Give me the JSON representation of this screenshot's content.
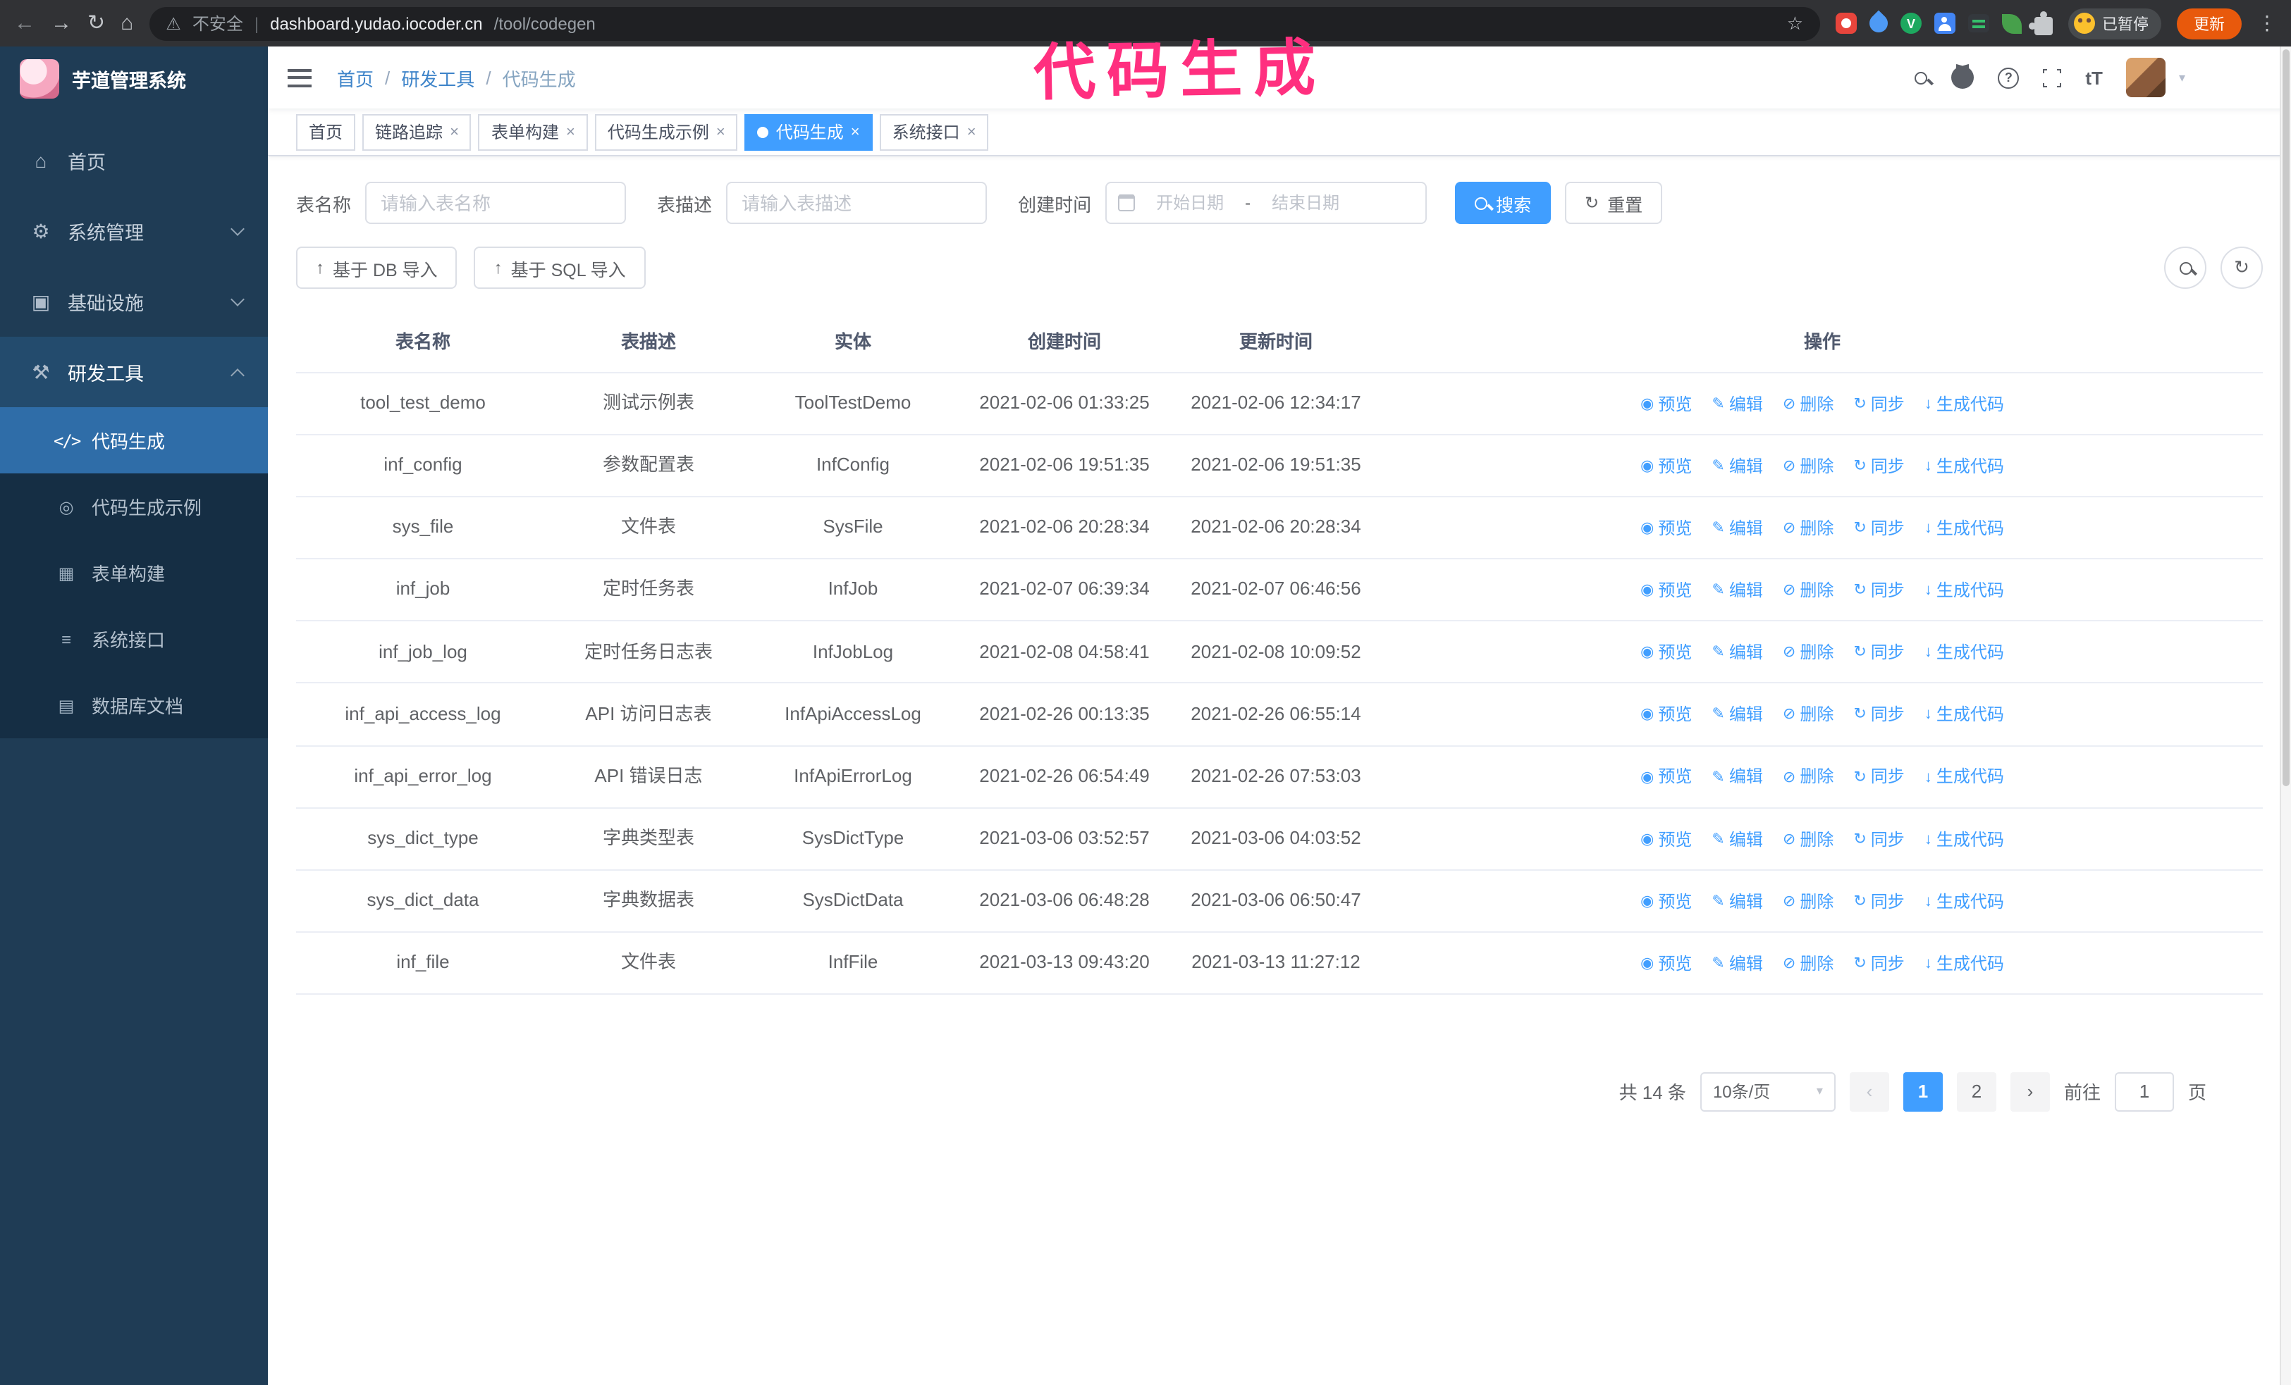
{
  "colors": {
    "accent": "#409EFF",
    "annotation": "#ff2f7f",
    "sidebar_bg": "#1f3c55",
    "sidebar_sub": "#152e44",
    "sidebar_active": "#2f6da8",
    "update_button": "#e8590c",
    "chrome_bar": "#313235",
    "chrome_pill": "#1f2023"
  },
  "chrome": {
    "security_label": "不安全",
    "url_domain": "dashboard.yudao.iocoder.cn",
    "url_path": "/tool/codegen",
    "profile_status": "已暂停",
    "update_label": "更新"
  },
  "annotation": {
    "text": "代码生成"
  },
  "sidebar": {
    "title": "芋道管理系统",
    "items": [
      {
        "label": "首页"
      },
      {
        "label": "系统管理",
        "chevron": "down"
      },
      {
        "label": "基础设施",
        "chevron": "down"
      },
      {
        "label": "研发工具",
        "chevron": "up",
        "expanded": true,
        "children": [
          {
            "label": "代码生成",
            "active": true
          },
          {
            "label": "代码生成示例"
          },
          {
            "label": "表单构建"
          },
          {
            "label": "系统接口"
          },
          {
            "label": "数据库文档"
          }
        ]
      }
    ]
  },
  "header": {
    "breadcrumb": [
      "首页",
      "研发工具",
      "代码生成"
    ],
    "separator": "/"
  },
  "tabs": [
    {
      "label": "首页",
      "closable": false,
      "active": false
    },
    {
      "label": "链路追踪",
      "closable": true,
      "active": false
    },
    {
      "label": "表单构建",
      "closable": true,
      "active": false
    },
    {
      "label": "代码生成示例",
      "closable": true,
      "active": false
    },
    {
      "label": "代码生成",
      "closable": true,
      "active": true
    },
    {
      "label": "系统接口",
      "closable": true,
      "active": false
    }
  ],
  "filters": {
    "table_name_label": "表名称",
    "table_name_placeholder": "请输入表名称",
    "table_desc_label": "表描述",
    "table_desc_placeholder": "请输入表描述",
    "create_time_label": "创建时间",
    "date_start_placeholder": "开始日期",
    "date_separator": "-",
    "date_end_placeholder": "结束日期",
    "search_label": "搜索",
    "reset_label": "重置"
  },
  "toolbar": {
    "import_db_label": "基于 DB 导入",
    "import_sql_label": "基于 SQL 导入"
  },
  "table": {
    "columns": [
      "表名称",
      "表描述",
      "实体",
      "创建时间",
      "更新时间",
      "操作"
    ],
    "actions": [
      {
        "name": "preview",
        "label": "预览",
        "icon": "eye"
      },
      {
        "name": "edit",
        "label": "编辑",
        "icon": "edit"
      },
      {
        "name": "delete",
        "label": "删除",
        "icon": "delete"
      },
      {
        "name": "sync",
        "label": "同步",
        "icon": "sync"
      },
      {
        "name": "generate-code",
        "label": "生成代码",
        "icon": "download"
      }
    ],
    "rows": [
      [
        "tool_test_demo",
        "测试示例表",
        "ToolTestDemo",
        "2021-02-06 01:33:25",
        "2021-02-06 12:34:17"
      ],
      [
        "inf_config",
        "参数配置表",
        "InfConfig",
        "2021-02-06 19:51:35",
        "2021-02-06 19:51:35"
      ],
      [
        "sys_file",
        "文件表",
        "SysFile",
        "2021-02-06 20:28:34",
        "2021-02-06 20:28:34"
      ],
      [
        "inf_job",
        "定时任务表",
        "InfJob",
        "2021-02-07 06:39:34",
        "2021-02-07 06:46:56"
      ],
      [
        "inf_job_log",
        "定时任务日志表",
        "InfJobLog",
        "2021-02-08 04:58:41",
        "2021-02-08 10:09:52"
      ],
      [
        "inf_api_access_log",
        "API 访问日志表",
        "InfApiAccessLog",
        "2021-02-26 00:13:35",
        "2021-02-26 06:55:14"
      ],
      [
        "inf_api_error_log",
        "API 错误日志",
        "InfApiErrorLog",
        "2021-02-26 06:54:49",
        "2021-02-26 07:53:03"
      ],
      [
        "sys_dict_type",
        "字典类型表",
        "SysDictType",
        "2021-03-06 03:52:57",
        "2021-03-06 04:03:52"
      ],
      [
        "sys_dict_data",
        "字典数据表",
        "SysDictData",
        "2021-03-06 06:48:28",
        "2021-03-06 06:50:47"
      ],
      [
        "inf_file",
        "文件表",
        "InfFile",
        "2021-03-13 09:43:20",
        "2021-03-13 11:27:12"
      ]
    ]
  },
  "pagination": {
    "total_label": "共 14 条",
    "page_size_label": "10条/页",
    "pages": [
      "1",
      "2"
    ],
    "active_page": "1",
    "goto_label": "前往",
    "goto_value": "1",
    "goto_suffix": "页"
  }
}
